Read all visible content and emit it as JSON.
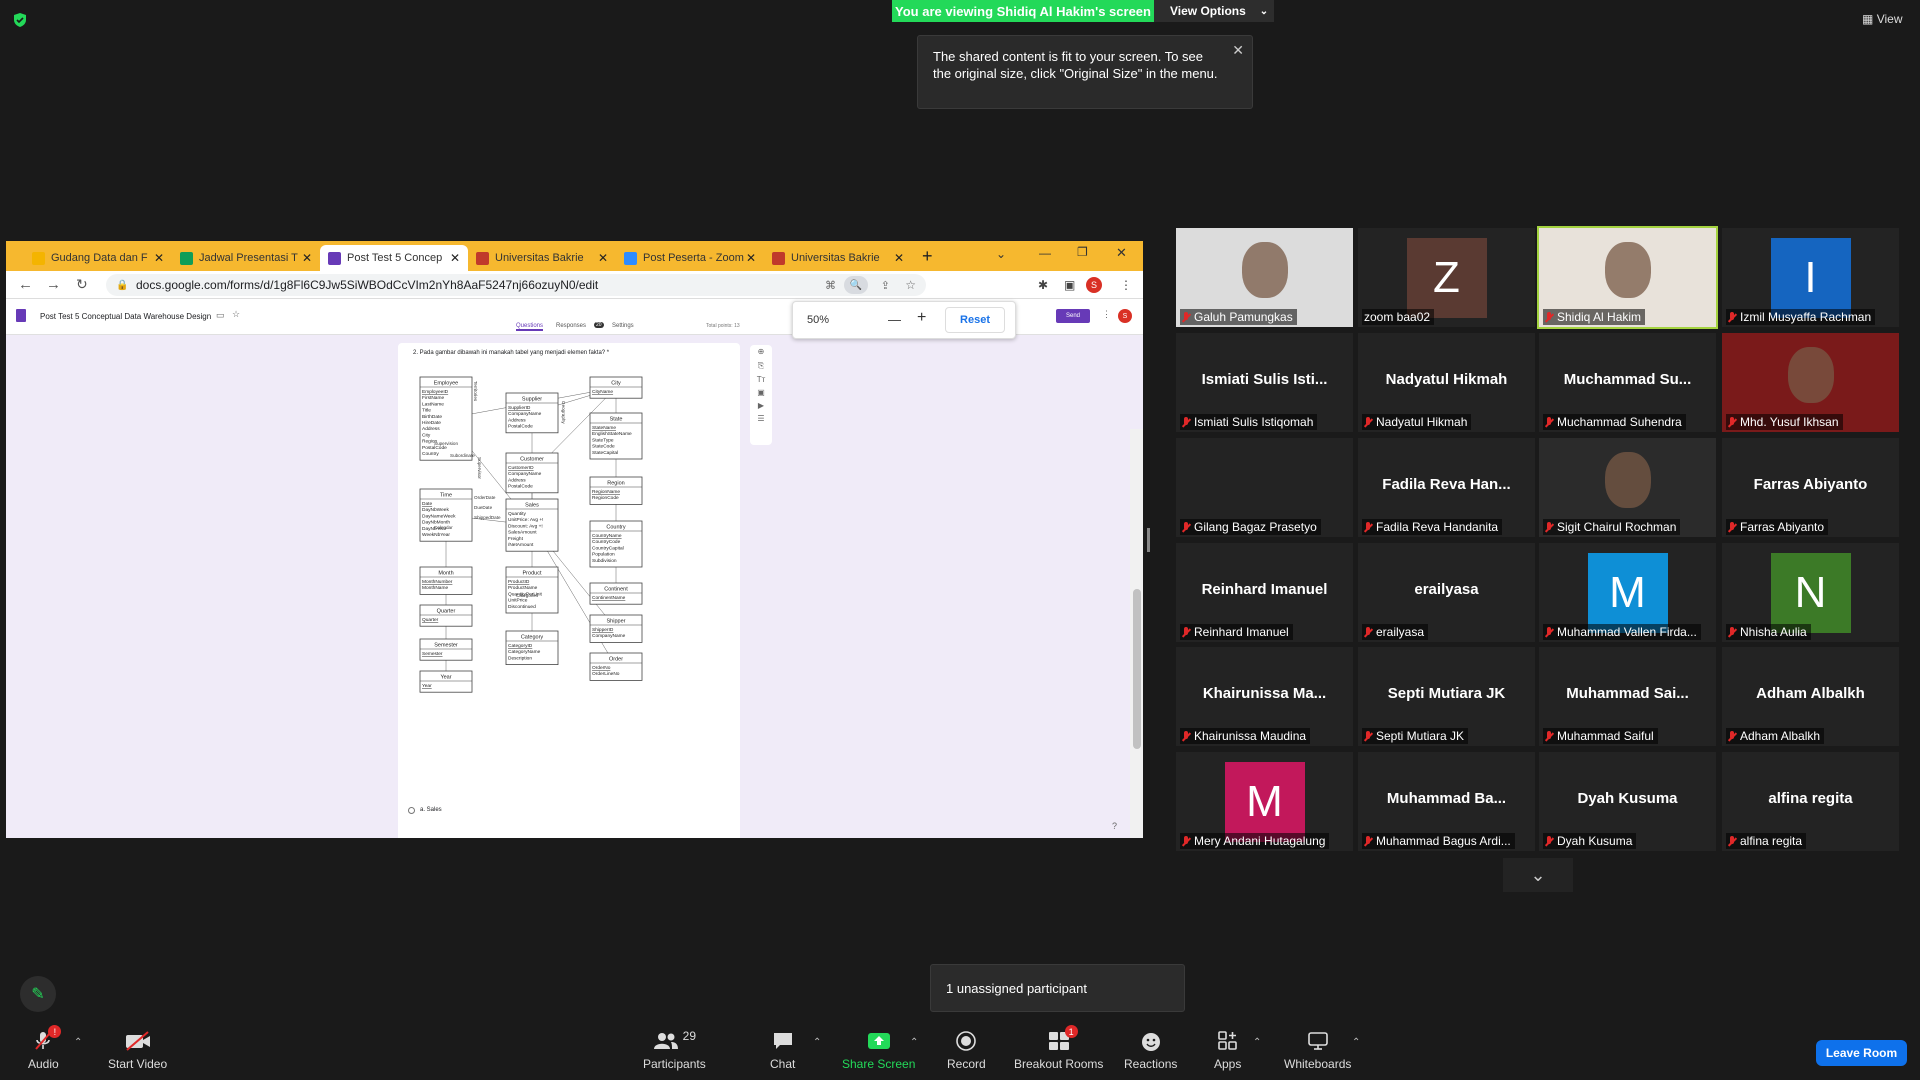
{
  "banner": {
    "viewing": "You are viewing Shidiq Al Hakim's screen",
    "view_options": "View Options",
    "view": "View"
  },
  "tooltip": {
    "text": "The shared content is fit to your screen. To see the original size, click \"Original Size\" in the menu."
  },
  "browser": {
    "tabs": [
      {
        "label": "Gudang Data dan F",
        "color": "#f4b400"
      },
      {
        "label": "Jadwal Presentasi T",
        "color": "#0f9d58"
      },
      {
        "label": "Post Test 5 Concep",
        "color": "#673ab7"
      },
      {
        "label": "Universitas Bakrie",
        "color": "#c0392b"
      },
      {
        "label": "Post Peserta - Zoom",
        "color": "#2d8cff"
      },
      {
        "label": "Universitas Bakrie",
        "color": "#c0392b"
      }
    ],
    "url": "docs.google.com/forms/d/1g8Fl6C9Jw5SiWBOdCcVIm2nYh8AaF5247nj66ozuyN0/edit",
    "profile_initial": "S"
  },
  "form": {
    "title": "Post Test 5 Conceptual Data Warehouse Design",
    "tabs": [
      "Questions",
      "Responses",
      "Settings"
    ],
    "responses_count": "20",
    "total_points": "Total points: 13",
    "send": "Send",
    "question": "2. Pada gambar dibawah ini manakah tabel yang menjadi elemen fakta? *",
    "option_a": "a. Sales"
  },
  "zoom_popup": {
    "level": "50%",
    "minus": "—",
    "plus": "+",
    "reset": "Reset"
  },
  "diagram": {
    "entities": [
      {
        "id": "employee",
        "title": "Employee",
        "fields": [
          "EmployeeID",
          "FirstName",
          "LastName",
          "Title",
          "BirthDate",
          "HireDate",
          "Address",
          "City",
          "Region",
          "PostalCode",
          "Country"
        ]
      },
      {
        "id": "supplier",
        "title": "Supplier",
        "fields": [
          "SupplierID",
          "CompanyName",
          "Address",
          "PostalCode"
        ]
      },
      {
        "id": "customer",
        "title": "Customer",
        "fields": [
          "CustomerID",
          "CompanyName",
          "Address",
          "PostalCode"
        ]
      },
      {
        "id": "city",
        "title": "City",
        "fields": [
          "CityName"
        ]
      },
      {
        "id": "state",
        "title": "State",
        "fields": [
          "StateName",
          "EnglishStateName",
          "StateType",
          "StateCode",
          "StateCapital"
        ]
      },
      {
        "id": "region",
        "title": "Region",
        "fields": [
          "RegionName",
          "RegionCode"
        ]
      },
      {
        "id": "country",
        "title": "Country",
        "fields": [
          "CountryName",
          "CountryCode",
          "CountryCapital",
          "Population",
          "Subdivision"
        ]
      },
      {
        "id": "continent",
        "title": "Continent",
        "fields": [
          "ContinentName"
        ]
      },
      {
        "id": "time",
        "title": "Time",
        "fields": [
          "Date",
          "DayNbWeek",
          "DayNameWeek",
          "DayNbMonth",
          "DayNbYear",
          "WeekNbYear"
        ]
      },
      {
        "id": "sales",
        "title": "Sales",
        "fields": [
          "Quantity",
          "UnitPrice: Avg +!",
          "Discount: Avg +!",
          "SalesAmount",
          "Freight",
          "/NetAmount"
        ]
      },
      {
        "id": "product",
        "title": "Product",
        "fields": [
          "ProductID",
          "ProductName",
          "QuantityPerUnit",
          "UnitPrice",
          "Discontinued"
        ]
      },
      {
        "id": "category",
        "title": "Category",
        "fields": [
          "CategoryID",
          "CategoryName",
          "Description"
        ]
      },
      {
        "id": "shipper",
        "title": "Shipper",
        "fields": [
          "ShipperID",
          "CompanyName"
        ]
      },
      {
        "id": "order",
        "title": "Order",
        "fields": [
          "OrderNo",
          "OrderLineNo"
        ]
      },
      {
        "id": "month",
        "title": "Month",
        "fields": [
          "MonthNumber",
          "MonthName"
        ]
      },
      {
        "id": "quarter",
        "title": "Quarter",
        "fields": [
          "Quarter"
        ]
      },
      {
        "id": "semester",
        "title": "Semester",
        "fields": [
          "Semester"
        ]
      },
      {
        "id": "year",
        "title": "Year",
        "fields": [
          "Year"
        ]
      }
    ],
    "hierarchy_labels": [
      "Territories",
      "Supervision",
      "Subordinate",
      "Supervisor",
      "Geography",
      "Calendar",
      "Categories",
      "OrderDate",
      "DueDate",
      "ShippedDate"
    ]
  },
  "participants": [
    {
      "name": "Galuh Pamungkas",
      "kind": "photo",
      "color": "#dcdcdc"
    },
    {
      "name": "zoom baa02",
      "kind": "avatar",
      "initial": "Z",
      "color": "#5a3a32"
    },
    {
      "name": "Shidiq Al Hakim",
      "kind": "photo",
      "color": "#e8e2da",
      "active": true
    },
    {
      "name": "Izmil Musyaffa Rachman",
      "kind": "avatar",
      "initial": "I",
      "color": "#1565c0"
    },
    {
      "name": "Ismiati Sulis Istiqomah",
      "big": "Ismiati Sulis Isti..."
    },
    {
      "name": "Nadyatul Hikmah",
      "big": "Nadyatul Hikmah"
    },
    {
      "name": "Muchammad Suhendra",
      "big": "Muchammad Su..."
    },
    {
      "name": "Mhd. Yusuf Ikhsan",
      "kind": "photo",
      "color": "#7a1a1a"
    },
    {
      "name": "Gilang Bagaz Prasetyo",
      "kind": "blank"
    },
    {
      "name": "Fadila Reva Handanita",
      "big": "Fadila Reva Han..."
    },
    {
      "name": "Sigit Chairul Rochman",
      "kind": "photo",
      "color": "#2b2b2b"
    },
    {
      "name": "Farras Abiyanto",
      "big": "Farras Abiyanto"
    },
    {
      "name": "Reinhard Imanuel",
      "big": "Reinhard Imanuel"
    },
    {
      "name": "erailyasa",
      "big": "erailyasa"
    },
    {
      "name": "Muhammad Vallen Firda...",
      "kind": "avatar",
      "initial": "M",
      "color": "#0e8fd6"
    },
    {
      "name": "Nhisha Aulia",
      "kind": "avatar",
      "initial": "N",
      "color": "#3c7a27"
    },
    {
      "name": "Khairunissa Maudina",
      "big": "Khairunissa Ma..."
    },
    {
      "name": "Septi Mutiara JK",
      "big": "Septi Mutiara JK"
    },
    {
      "name": "Muhammad Saiful",
      "big": "Muhammad Sai..."
    },
    {
      "name": "Adham Albalkh",
      "big": "Adham Albalkh"
    },
    {
      "name": "Mery Andani Hutagalung",
      "kind": "avatar",
      "initial": "M",
      "color": "#c2185b"
    },
    {
      "name": "Muhammad Bagus Ardi...",
      "big": "Muhammad Ba..."
    },
    {
      "name": "Dyah Kusuma",
      "big": "Dyah Kusuma"
    },
    {
      "name": "alfina regita",
      "big": "alfina regita"
    }
  ],
  "unassigned": "1 unassigned participant",
  "toolbar": {
    "audio": "Audio",
    "audio_badge": "!",
    "start_video": "Start Video",
    "participants": "Participants",
    "participants_count": "29",
    "chat": "Chat",
    "share_screen": "Share Screen",
    "record": "Record",
    "breakout_rooms": "Breakout Rooms",
    "breakout_badge": "1",
    "reactions": "Reactions",
    "apps": "Apps",
    "whiteboards": "Whiteboards",
    "leave": "Leave Room"
  },
  "colors": {
    "green": "#23d959",
    "blue": "#0e71eb",
    "tab_bar": "#f6b82f",
    "form_bg": "#f0ebf8",
    "forms_purple": "#673ab7",
    "active_border": "#a4d33f"
  }
}
